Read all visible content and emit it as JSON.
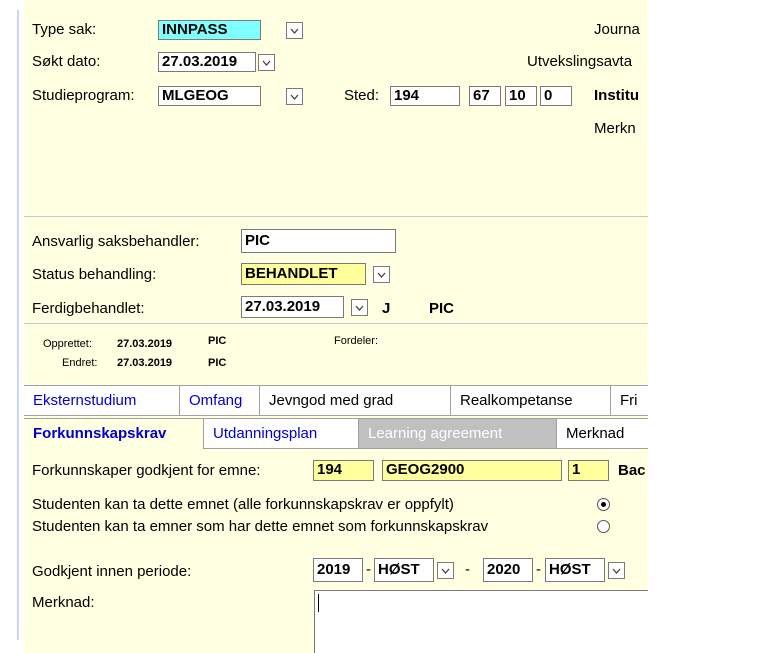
{
  "top": {
    "type_sak_label": "Type sak:",
    "type_sak_value": "INNPASS",
    "sokt_dato_label": "Søkt dato:",
    "sokt_dato_value": "27.03.2019",
    "studieprogram_label": "Studieprogram:",
    "studieprogram_value": "MLGEOG",
    "sted_label": "Sted:",
    "sted_values": [
      "194",
      "67",
      "10",
      "0"
    ],
    "right_labels": [
      "Journa",
      "Utvekslingsavta",
      "Institu",
      "Merkn"
    ]
  },
  "behandling": {
    "ansvarlig_label": "Ansvarlig saksbehandler:",
    "ansvarlig_value": "PIC",
    "status_label": "Status behandling:",
    "status_value": "BEHANDLET",
    "ferdig_label": "Ferdigbehandlet:",
    "ferdig_value": "27.03.2019",
    "ferdig_flag": "J",
    "ferdig_user": "PIC"
  },
  "audit": {
    "opprettet_label": "Opprettet:",
    "opprettet_date": "27.03.2019",
    "opprettet_user": "PIC",
    "endret_label": "Endret:",
    "endret_date": "27.03.2019",
    "endret_user": "PIC",
    "fordeler_label": "Fordeler:"
  },
  "tabs_row1": [
    "Eksternstudium",
    "Omfang",
    "Jevngod med grad",
    "Realkompetanse",
    "Fri"
  ],
  "tabs_row2": [
    "Forkunnskapskrav",
    "Utdanningsplan",
    "Learning agreement",
    "Merknad"
  ],
  "panel": {
    "godkjent_label": "Forkunnskaper godkjent for emne:",
    "emne_sted": "194",
    "emne_kode": "GEOG2900",
    "emne_versjon": "1",
    "emne_trunc": "Bac",
    "radio1_label": "Studenten kan ta dette emnet (alle forkunnskapskrav er oppfylt)",
    "radio2_label": "Studenten kan ta emner som har dette emnet som forkunnskapskrav",
    "periode_label": "Godkjent innen periode:",
    "fra_ar": "2019",
    "fra_termin": "HØST",
    "til_ar": "2020",
    "til_termin": "HØST",
    "dash": "-",
    "merknad_label": "Merknad:"
  }
}
